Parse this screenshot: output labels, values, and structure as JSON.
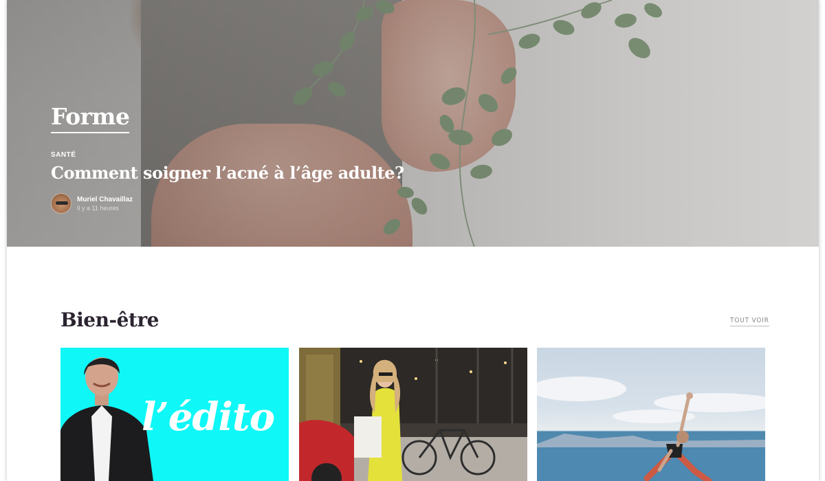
{
  "hero": {
    "category": "Forme",
    "tag": "Santé",
    "headline": "Comment soigner l’acné à l’âge adulte?",
    "author": {
      "name": "Muriel Chavaillaz",
      "time": "Il y a 11 heures"
    }
  },
  "section": {
    "title": "Bien-être",
    "see_all": "TOUT VOIR"
  },
  "cards": [
    {
      "overlay_text": "l’édito",
      "bg_color": "#0ff7f7"
    },
    {
      "overlay_text": ""
    },
    {
      "overlay_text": ""
    }
  ],
  "colors": {
    "title_dark": "#2c2430",
    "edito_cyan": "#0ff7f7"
  }
}
